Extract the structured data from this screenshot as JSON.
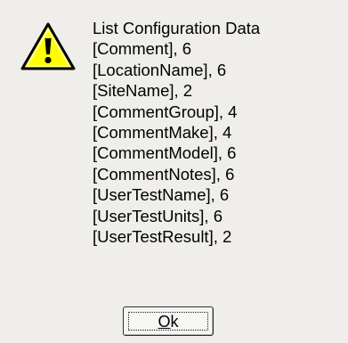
{
  "dialog": {
    "icon": "warning-icon",
    "message_lines": [
      "List Configuration Data",
      "[Comment], 6",
      "[LocationName], 6",
      "[SiteName], 2",
      "[CommentGroup], 4",
      "[CommentMake], 4",
      "[CommentModel], 6",
      "[CommentNotes], 6",
      "[UserTestName], 6",
      "[UserTestUnits], 6",
      "[UserTestResult], 2"
    ],
    "ok_button": {
      "mnemonic": "O",
      "rest": "k"
    }
  },
  "colors": {
    "background": "#efeeeb",
    "warning_fill": "#ffff00",
    "warning_outline": "#000000"
  }
}
